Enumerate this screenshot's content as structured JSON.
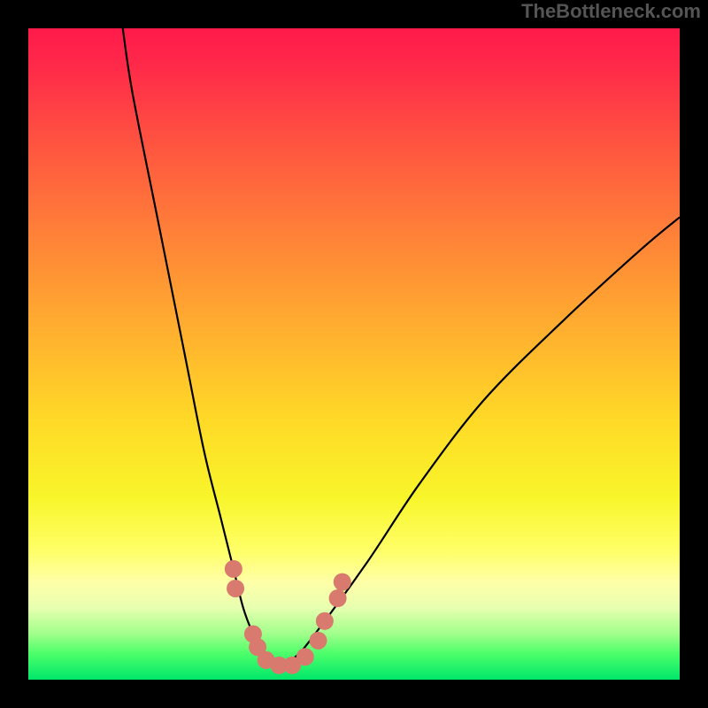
{
  "watermark": "TheBottleneck.com",
  "frame": {
    "outer_size": 800,
    "border": 32,
    "border_color": "#000000"
  },
  "gradient": {
    "stops": [
      {
        "offset": 0.0,
        "color": "#ff1a4a"
      },
      {
        "offset": 0.06,
        "color": "#ff2a49"
      },
      {
        "offset": 0.18,
        "color": "#ff5540"
      },
      {
        "offset": 0.32,
        "color": "#ff8238"
      },
      {
        "offset": 0.46,
        "color": "#ffae2f"
      },
      {
        "offset": 0.6,
        "color": "#ffd927"
      },
      {
        "offset": 0.72,
        "color": "#f8f52a"
      },
      {
        "offset": 0.8,
        "color": "#ffff66"
      },
      {
        "offset": 0.85,
        "color": "#ffffa8"
      },
      {
        "offset": 0.89,
        "color": "#e7ffb0"
      },
      {
        "offset": 0.93,
        "color": "#9fff8a"
      },
      {
        "offset": 0.96,
        "color": "#4cff6a"
      },
      {
        "offset": 1.0,
        "color": "#00e66a"
      }
    ]
  },
  "chart_data": {
    "type": "line",
    "title": "",
    "xlabel": "",
    "ylabel": "",
    "xlim": [
      0,
      100
    ],
    "ylim": [
      0,
      100
    ],
    "series": [
      {
        "name": "curve",
        "x": [
          14.5,
          16,
          20,
          24,
          27,
          29.5,
          31.5,
          33,
          34.5,
          36,
          38.5,
          41,
          44,
          52,
          60,
          70,
          82,
          94,
          100
        ],
        "values": [
          100,
          90,
          70,
          50,
          35,
          25,
          17,
          11,
          7,
          4,
          2.5,
          3.5,
          7,
          18,
          30,
          43,
          55,
          66,
          71
        ]
      }
    ],
    "markers": [
      {
        "x": 31.5,
        "y": 17
      },
      {
        "x": 31.8,
        "y": 14
      },
      {
        "x": 34.5,
        "y": 7
      },
      {
        "x": 35.2,
        "y": 5
      },
      {
        "x": 36.5,
        "y": 3
      },
      {
        "x": 38.5,
        "y": 2.2
      },
      {
        "x": 40.5,
        "y": 2.2
      },
      {
        "x": 42.5,
        "y": 3.5
      },
      {
        "x": 44.5,
        "y": 6
      },
      {
        "x": 45.5,
        "y": 9
      },
      {
        "x": 47.5,
        "y": 12.5
      },
      {
        "x": 48.2,
        "y": 15
      }
    ]
  },
  "marker_color": "#d87a6e",
  "curve_color": "#000000",
  "watermark_color": "#555555"
}
